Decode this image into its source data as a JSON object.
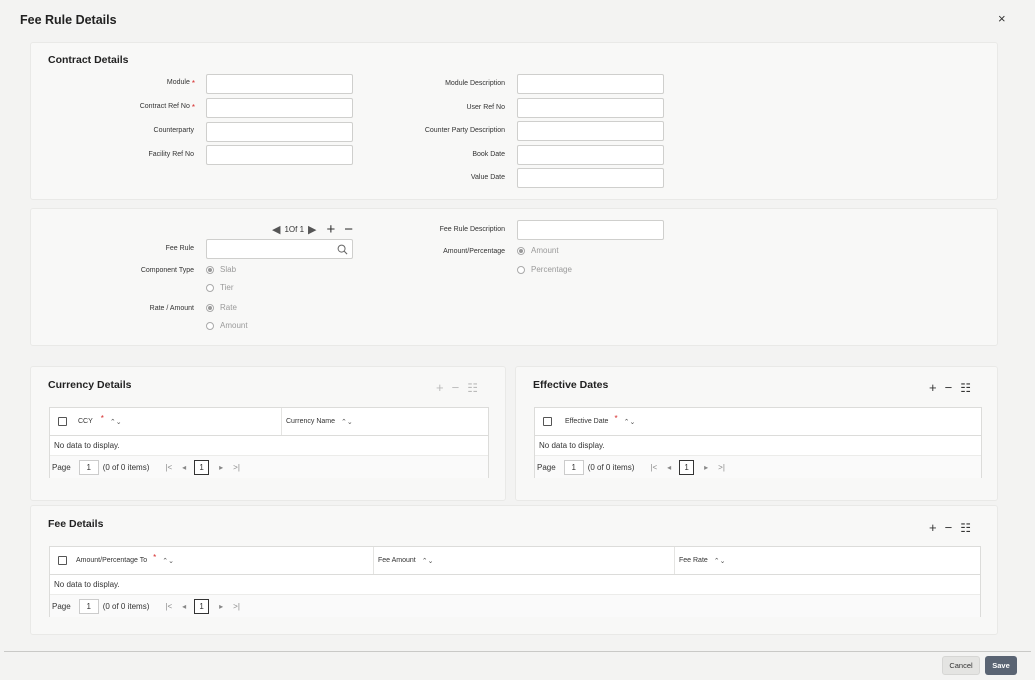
{
  "window": {
    "title": "Fee Rule Details",
    "close": "×"
  },
  "contract": {
    "title": "Contract Details",
    "module_label": "Module",
    "contract_ref_label": "Contract Ref No",
    "counterparty_label": "Counterparty",
    "facility_ref_label": "Facility Ref No",
    "module_desc_label": "Module Description",
    "user_ref_label": "User Ref No",
    "counterparty_desc_label": "Counter Party Description",
    "book_date_label": "Book Date",
    "value_date_label": "Value Date",
    "required_mark": "*"
  },
  "feerule": {
    "nav_text": "1Of 1",
    "fee_rule_label": "Fee Rule",
    "component_type_label": "Component Type",
    "slab": "Slab",
    "tier": "Tier",
    "rate_amount_label": "Rate / Amount",
    "rate": "Rate",
    "amount": "Amount",
    "fee_rule_desc_label": "Fee Rule Description",
    "amount_pct_label": "Amount/Percentage",
    "amount_opt": "Amount",
    "percentage_opt": "Percentage"
  },
  "currency": {
    "title": "Currency Details",
    "col1": "CCY",
    "col2": "Currency Name",
    "nodata": "No data to display.",
    "page_label": "Page",
    "page_num": "1",
    "items": "(0 of 0 items)",
    "current_page": "1"
  },
  "effective": {
    "title": "Effective Dates",
    "col1": "Effective Date",
    "nodata": "No data to display.",
    "page_label": "Page",
    "page_num": "1",
    "items": "(0 of 0 items)",
    "current_page": "1"
  },
  "fee": {
    "title": "Fee Details",
    "col1": "Amount/Percentage To",
    "col2": "Fee Amount",
    "col3": "Fee Rate",
    "nodata": "No data to display.",
    "page_label": "Page",
    "page_num": "1",
    "items": "(0 of 0 items)",
    "current_page": "1"
  },
  "footer": {
    "cancel": "Cancel",
    "save": "Save"
  },
  "icons": {
    "first": "|<",
    "prev": "◂",
    "next": "▸",
    "last": ">|",
    "sort": "⌃⌄"
  }
}
